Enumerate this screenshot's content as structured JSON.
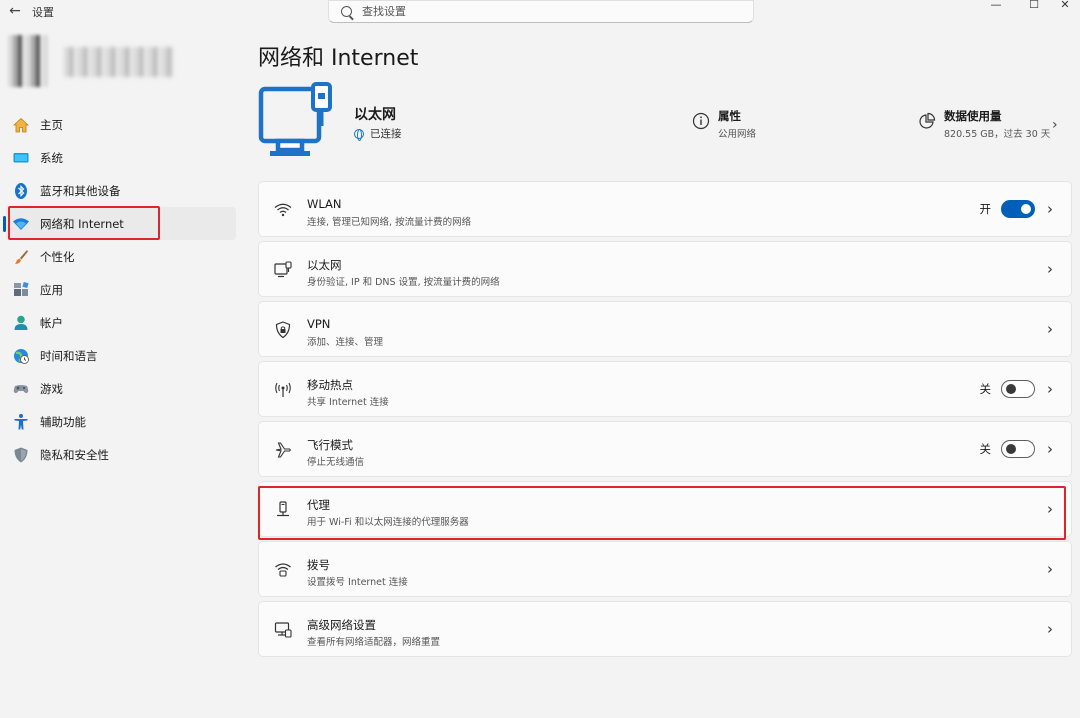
{
  "titlebar": {
    "back_icon": "back-arrow-icon",
    "title": "设置",
    "search_placeholder": "查找设置",
    "minimize": "—",
    "maximize": "☐",
    "close": "✕"
  },
  "sidebar": {
    "items": [
      {
        "label": "主页",
        "icon": "home-icon"
      },
      {
        "label": "系统",
        "icon": "system-icon"
      },
      {
        "label": "蓝牙和其他设备",
        "icon": "bluetooth-icon"
      },
      {
        "label": "网络和 Internet",
        "icon": "network-icon",
        "active": true
      },
      {
        "label": "个性化",
        "icon": "brush-icon"
      },
      {
        "label": "应用",
        "icon": "apps-icon"
      },
      {
        "label": "帐户",
        "icon": "account-icon"
      },
      {
        "label": "时间和语言",
        "icon": "time-language-icon"
      },
      {
        "label": "游戏",
        "icon": "gaming-icon"
      },
      {
        "label": "辅助功能",
        "icon": "accessibility-icon"
      },
      {
        "label": "隐私和安全性",
        "icon": "shield-icon"
      }
    ]
  },
  "main": {
    "page_title": "网络和 Internet",
    "hero": {
      "name": "以太网",
      "status": "已连接",
      "properties_title": "属性",
      "properties_sub": "公用网络",
      "usage_title": "数据使用量",
      "usage_sub": "820.55 GB，过去 30 天"
    },
    "cards": [
      {
        "title": "WLAN",
        "sub": "连接, 管理已知网络, 按流量计费的网络",
        "icon": "wifi-icon",
        "toggle": "开",
        "toggle_state": "on"
      },
      {
        "title": "以太网",
        "sub": "身份验证, IP 和 DNS 设置, 按流量计费的网络",
        "icon": "ethernet-icon"
      },
      {
        "title": "VPN",
        "sub": "添加、连接、管理",
        "icon": "vpn-shield-icon"
      },
      {
        "title": "移动热点",
        "sub": "共享 Internet 连接",
        "icon": "hotspot-icon",
        "toggle": "关",
        "toggle_state": "off"
      },
      {
        "title": "飞行模式",
        "sub": "停止无线通信",
        "icon": "airplane-icon",
        "toggle": "关",
        "toggle_state": "off"
      },
      {
        "title": "代理",
        "sub": "用于 Wi-Fi 和以太网连接的代理服务器",
        "icon": "proxy-icon"
      },
      {
        "title": "拨号",
        "sub": "设置拨号 Internet 连接",
        "icon": "dialup-icon"
      },
      {
        "title": "高级网络设置",
        "sub": "查看所有网络适配器，网络重置",
        "icon": "advanced-network-icon"
      }
    ]
  },
  "colors": {
    "accent": "#005fb8",
    "highlight_box": "#e1232b",
    "monitor_icon": "#1e73c8"
  }
}
